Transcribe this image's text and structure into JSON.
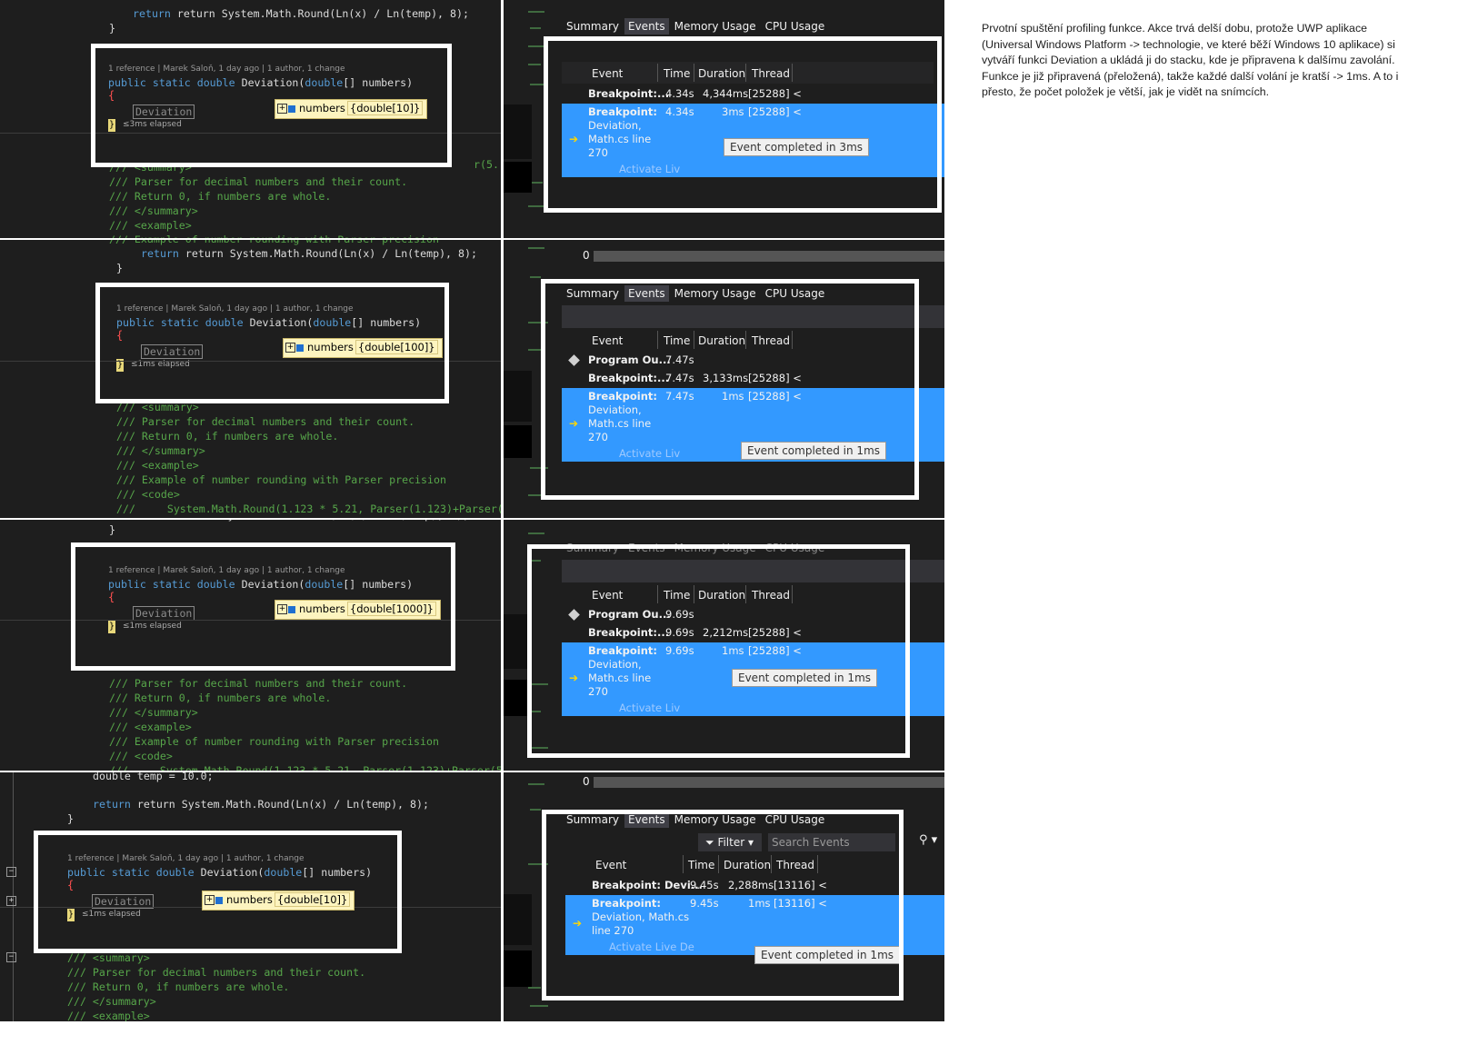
{
  "note": "Prvotní spuštění profiling funkce. Akce trvá delší dobu, protože UWP aplikace (Universal Windows Platform -> technologie, ve které běží Windows 10 aplikace) si vytváří funkci Deviation a ukládá ji do stacku, kde je připravena k dalšímu zavolání. Funkce je již připravená  (přeložená), takže každé další volání je kratší -> 1ms. A to i přesto, že počet položek je větší, jak je vidět na snímcích.",
  "code": {
    "return_line": "return System.Math.Round(Ln(x) / Ln(temp), 8);",
    "closing_brace": "}",
    "codelens": "1 reference | Marek Saloň, 1 day ago | 1 author, 1 change",
    "signature_kw": "public static double",
    "signature_name": "Deviation(",
    "signature_param_type": "double",
    "signature_rest": "[] numbers)",
    "open_brace": "{",
    "ghost_text": "Deviation",
    "datatip_name": "numbers",
    "comments": [
      "/// <summary>",
      "/// Parser for decimal numbers and their count.",
      "/// Return 0, if numbers are whole.",
      "/// </summary>",
      "/// <example>",
      "/// Example of number rounding with Parser precision",
      "/// <code>",
      "///     System.Math.Round(1.123 * 5.21, Parser(1.123)+Parser(5"
    ],
    "double_temp": "double temp = 10.0;",
    "side_snip": "r(5."
  },
  "panel": {
    "tabs": [
      "Summary",
      "Events",
      "Memory Usage",
      "CPU Usage"
    ],
    "selected_tab": "Events",
    "columns": [
      "Event",
      "Time",
      "Duration",
      "Thread"
    ],
    "filter_label": "Filter",
    "search_placeholder": "Search Events",
    "zero": "0",
    "activate": "Activate Liv",
    "activate_full": "Activate Live De"
  },
  "snapshots": [
    {
      "datatip_value": "{double[10]}",
      "elapsed": "≤3ms elapsed",
      "rows": [
        {
          "event": "Breakpoint:...",
          "time": "4.34s",
          "duration": "4,344ms",
          "thread": "[25288] <"
        },
        {
          "event": "Breakpoint:",
          "detail": [
            "Deviation,",
            "Math.cs line",
            "270"
          ],
          "time": "4.34s",
          "duration": "3ms",
          "thread": "[25288] <",
          "selected": true
        }
      ],
      "toast": "Event completed in 3ms"
    },
    {
      "datatip_value": "{double[100]}",
      "elapsed": "≤1ms elapsed",
      "rows": [
        {
          "event": "Program Ou...",
          "time": "7.47s",
          "duration": "",
          "thread": ""
        },
        {
          "event": "Breakpoint:...",
          "time": "7.47s",
          "duration": "3,133ms",
          "thread": "[25288] <"
        },
        {
          "event": "Breakpoint:",
          "detail": [
            "Deviation,",
            "Math.cs line",
            "270"
          ],
          "time": "7.47s",
          "duration": "1ms",
          "thread": "[25288] <",
          "selected": true
        }
      ],
      "toast": "Event completed in 1ms"
    },
    {
      "datatip_value": "{double[1000]}",
      "elapsed": "≤1ms elapsed",
      "rows": [
        {
          "event": "Program Ou...",
          "time": "9.69s",
          "duration": "",
          "thread": ""
        },
        {
          "event": "Breakpoint:...",
          "time": "9.69s",
          "duration": "2,212ms",
          "thread": "[25288] <"
        },
        {
          "event": "Breakpoint:",
          "detail": [
            "Deviation,",
            "Math.cs line",
            "270"
          ],
          "time": "9.69s",
          "duration": "1ms",
          "thread": "[25288] <",
          "selected": true
        }
      ],
      "toast": "Event completed in 1ms"
    },
    {
      "datatip_value": "{double[10]}",
      "elapsed": "≤1ms elapsed",
      "rows": [
        {
          "event": "Breakpoint: Devi...",
          "time": "9.45s",
          "duration": "2,288ms",
          "thread": "[13116] <"
        },
        {
          "event": "Breakpoint:",
          "detail": [
            "Deviation, Math.cs",
            "line 270"
          ],
          "time": "9.45s",
          "duration": "1ms",
          "thread": "[13116] <",
          "selected": true
        }
      ],
      "toast": "Event completed in 1ms"
    }
  ]
}
